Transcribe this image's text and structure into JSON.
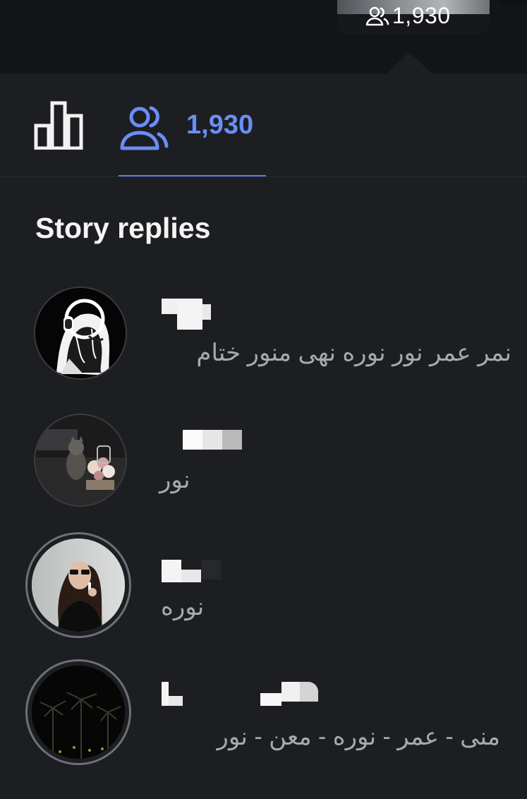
{
  "header": {
    "viewer_count": "1,930"
  },
  "tabs": {
    "insights_icon": "bar-chart-icon",
    "viewers_icon": "people-icon",
    "viewers_count": "1,930",
    "active": "viewers"
  },
  "section": {
    "title": "Story replies"
  },
  "replies": [
    {
      "avatar": "headphones-girl-avatar",
      "text": "نمر عمر نور نوره نهى منور ختام"
    },
    {
      "avatar": "cat-flowers-avatar",
      "text": "نور"
    },
    {
      "avatar": "woman-sunglasses-avatar",
      "text": "نوره"
    },
    {
      "avatar": "palm-trees-night-avatar",
      "text": "منى - عمر - نوره  - معن - نور"
    }
  ],
  "colors": {
    "background": "#1c1e21",
    "topbar": "#121417",
    "accent": "#6b8df5",
    "secondary_text": "#a7a9ad"
  }
}
